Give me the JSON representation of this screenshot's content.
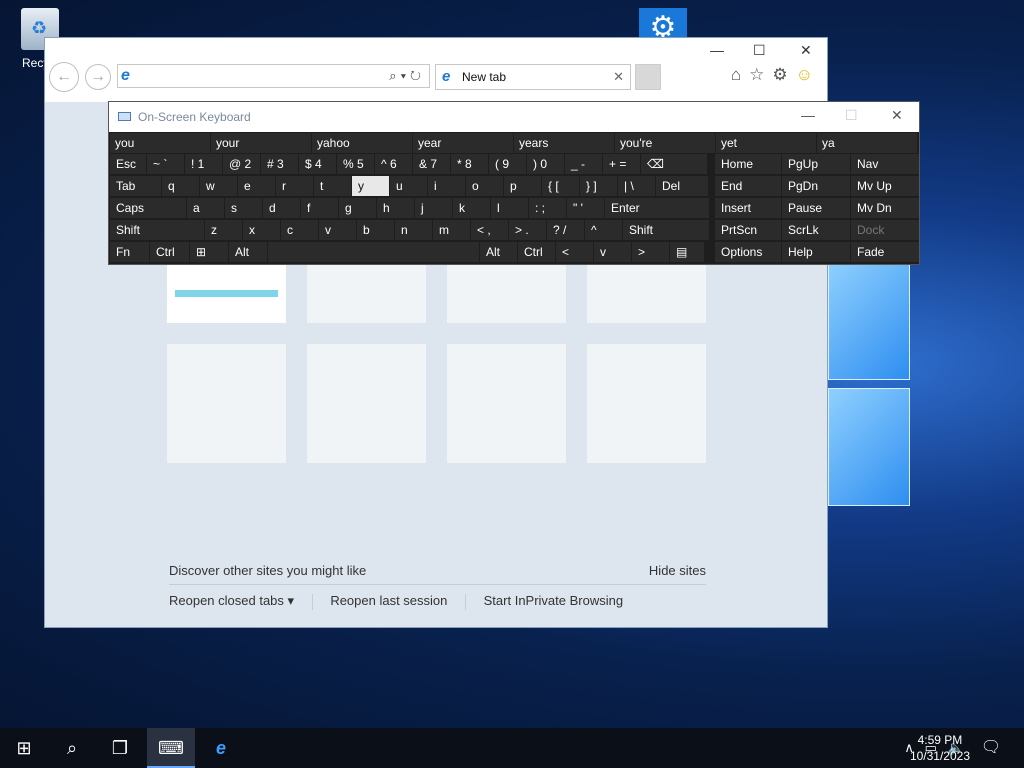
{
  "desktop": {
    "recycle_label": "Recycl",
    "settings_icon": "gear-icon"
  },
  "browser": {
    "tab_title": "New tab",
    "address_value": "",
    "discover_text": "Discover other sites you might like",
    "hide_sites": "Hide sites",
    "reopen_closed": "Reopen closed tabs ▾",
    "reopen_last": "Reopen last session",
    "inprivate": "Start InPrivate Browsing"
  },
  "osk": {
    "title": "On-Screen Keyboard",
    "suggestions": [
      "you",
      "your",
      "yahoo",
      "year",
      "years",
      "you're",
      "yet",
      "ya"
    ],
    "row1": [
      "Esc",
      "~ `",
      "! 1",
      "@ 2",
      "# 3",
      "$ 4",
      "% 5",
      "^ 6",
      "& 7",
      "* 8",
      "( 9",
      ") 0",
      "_ -",
      "+ =",
      "⌫"
    ],
    "row2": [
      "Tab",
      "q",
      "w",
      "e",
      "r",
      "t",
      "y",
      "u",
      "i",
      "o",
      "p",
      "{ [",
      "} ]",
      "| \\",
      "Del"
    ],
    "row3": [
      "Caps",
      "a",
      "s",
      "d",
      "f",
      "g",
      "h",
      "j",
      "k",
      "l",
      ": ;",
      "\" '",
      "Enter"
    ],
    "row4": [
      "Shift",
      "z",
      "x",
      "c",
      "v",
      "b",
      "n",
      "m",
      "< ,",
      "> .",
      "? /",
      "^",
      "Shift"
    ],
    "row5": [
      "Fn",
      "Ctrl",
      "⊞",
      "Alt",
      "",
      "Alt",
      "Ctrl",
      "<",
      "v",
      ">",
      "▤"
    ],
    "nav": [
      [
        "Home",
        "PgUp",
        "Nav"
      ],
      [
        "End",
        "PgDn",
        "Mv Up"
      ],
      [
        "Insert",
        "Pause",
        "Mv Dn"
      ],
      [
        "PrtScn",
        "ScrLk",
        "Dock"
      ],
      [
        "Options",
        "Help",
        "Fade"
      ]
    ]
  },
  "taskbar": {
    "time": "4:59 PM",
    "date": "10/31/2023"
  }
}
